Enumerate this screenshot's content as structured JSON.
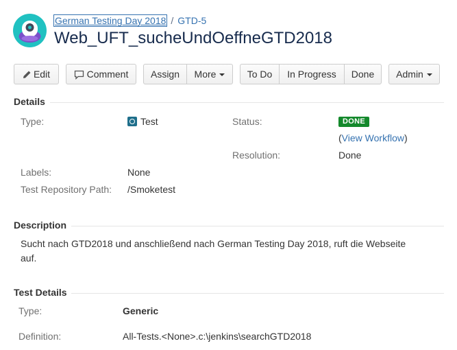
{
  "breadcrumb": {
    "project": "German Testing Day 2018",
    "issue_key": "GTD-5"
  },
  "issue": {
    "title": "Web_UFT_sucheUndOeffneGTD2018"
  },
  "toolbar": {
    "edit": "Edit",
    "comment": "Comment",
    "assign": "Assign",
    "more": "More",
    "todo": "To Do",
    "in_progress": "In Progress",
    "done": "Done",
    "admin": "Admin"
  },
  "details": {
    "heading": "Details",
    "type_label": "Type:",
    "type_value": "Test",
    "status_label": "Status:",
    "status_value": "DONE",
    "view_workflow": "View Workflow",
    "resolution_label": "Resolution:",
    "resolution_value": "Done",
    "labels_label": "Labels:",
    "labels_value": "None",
    "repo_path_label": "Test Repository Path:",
    "repo_path_value": "/Smoketest"
  },
  "description": {
    "heading": "Description",
    "text": "Sucht nach GTD2018 und anschließend nach German Testing Day 2018, ruft die Webseite auf."
  },
  "test_details": {
    "heading": "Test Details",
    "type_label": "Type:",
    "type_value": "Generic",
    "definition_label": "Definition:",
    "definition_value": "All-Tests.<None>.c:\\jenkins\\searchGTD2018"
  },
  "colors": {
    "link": "#3572b0",
    "status_done": "#14892c",
    "avatar_bg": "#20c1c1",
    "avatar_body": "#7b4fc9"
  }
}
